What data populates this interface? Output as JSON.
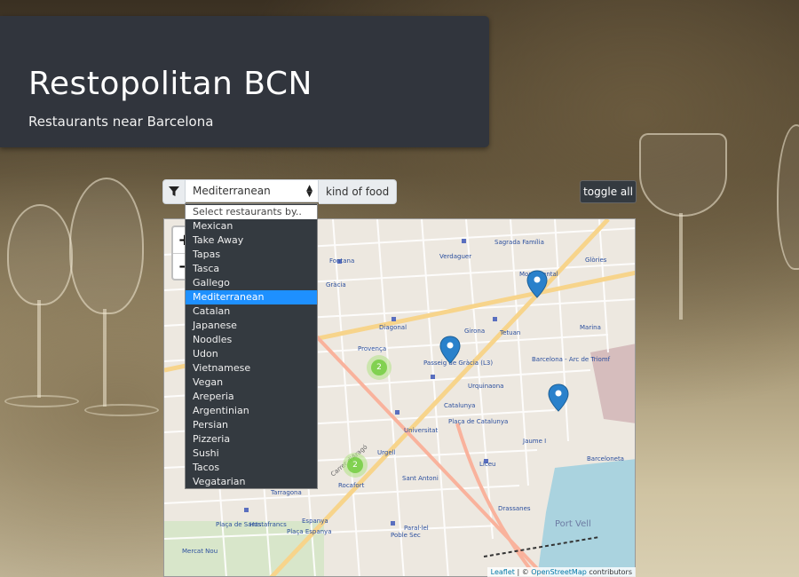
{
  "header": {
    "title": "Restopolitan BCN",
    "subtitle": "Restaurants near Barcelona"
  },
  "filter": {
    "selected": "Mediterranean",
    "kind_label": "kind of food",
    "placeholder": "Select restaurants by..",
    "options": [
      "Mexican",
      "Take Away",
      "Tapas",
      "Tasca",
      "Gallego",
      "Mediterranean",
      "Catalan",
      "Japanese",
      "Noodles",
      "Udon",
      "Vietnamese",
      "Vegan",
      "Areperia",
      "Argentinian",
      "Persian",
      "Pizzeria",
      "Sushi",
      "Tacos",
      "Vegatarian"
    ]
  },
  "toggle_label": "toggle all",
  "map": {
    "zoom_in": "+",
    "zoom_out": "−",
    "clusters": [
      "2",
      "2"
    ],
    "labels": [
      "Fontana",
      "Gràcia",
      "Verdaguer",
      "Sagrada Família",
      "Monumental",
      "Glòries",
      "Diagonal",
      "Girona",
      "Tetuan",
      "Marina",
      "Provença",
      "Passeig de Gràcia (L3)",
      "Barcelona - Arc de Triomf",
      "Urquinaona",
      "Catalunya",
      "Plaça de Catalunya",
      "Universitat",
      "Jaume I",
      "Liceu",
      "Urgell",
      "Sant Antoni",
      "Rocafort",
      "Drassanes",
      "Tarragona",
      "Espanya",
      "Plaça de Sants",
      "Hostafrancs",
      "Plaça Espanya",
      "Paral·lel",
      "Port Vell",
      "Mercat Nou",
      "Poble Sec",
      "Barceloneta",
      "Carrer d'Aragó"
    ],
    "attribution_leaflet": "Leaflet",
    "attribution_sep": " | © ",
    "attribution_osm": "OpenStreetMap",
    "attribution_tail": " contributors"
  },
  "colors": {
    "header_bg": "#31353d",
    "selected_option": "#1e90ff",
    "marker": "#2a81cb"
  }
}
